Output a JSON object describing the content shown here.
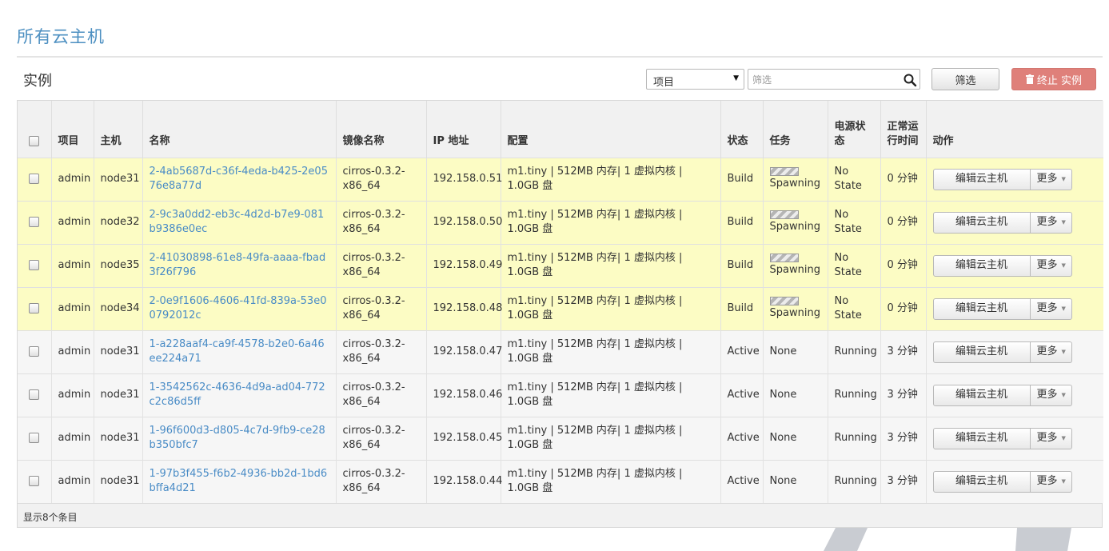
{
  "page": {
    "title": "所有云主机"
  },
  "section": {
    "heading": "实例"
  },
  "filter": {
    "project_option": "项目",
    "search_placeholder": "筛选",
    "filter_button": "筛选",
    "terminate_button": "终止 实例"
  },
  "table": {
    "headers": {
      "project": "项目",
      "host": "主机",
      "name": "名称",
      "image": "镜像名称",
      "ip": "IP 地址",
      "size": "配置",
      "status": "状态",
      "task": "任务",
      "power": "电源状态",
      "uptime": "正常运行时间",
      "actions": "动作"
    },
    "rows": [
      {
        "project": "admin",
        "host": "node31",
        "name": "2-4ab5687d-c36f-4eda-b425-2e0576e8a77d",
        "image": "cirros-0.3.2-x86_64",
        "ip": "192.158.0.51",
        "size": "m1.tiny | 512MB 内存| 1 虚拟内核 | 1.0GB 盘",
        "status": "Build",
        "task": "Spawning",
        "power": "No State",
        "uptime": "0 分钟",
        "edit": "编辑云主机",
        "more": "更多"
      },
      {
        "project": "admin",
        "host": "node32",
        "name": "2-9c3a0dd2-eb3c-4d2d-b7e9-081b9386e0ec",
        "image": "cirros-0.3.2-x86_64",
        "ip": "192.158.0.50",
        "size": "m1.tiny | 512MB 内存| 1 虚拟内核 | 1.0GB 盘",
        "status": "Build",
        "task": "Spawning",
        "power": "No State",
        "uptime": "0 分钟",
        "edit": "编辑云主机",
        "more": "更多"
      },
      {
        "project": "admin",
        "host": "node35",
        "name": "2-41030898-61e8-49fa-aaaa-fbad3f26f796",
        "image": "cirros-0.3.2-x86_64",
        "ip": "192.158.0.49",
        "size": "m1.tiny | 512MB 内存| 1 虚拟内核 | 1.0GB 盘",
        "status": "Build",
        "task": "Spawning",
        "power": "No State",
        "uptime": "0 分钟",
        "edit": "编辑云主机",
        "more": "更多"
      },
      {
        "project": "admin",
        "host": "node34",
        "name": "2-0e9f1606-4606-41fd-839a-53e00792012c",
        "image": "cirros-0.3.2-x86_64",
        "ip": "192.158.0.48",
        "size": "m1.tiny | 512MB 内存| 1 虚拟内核 | 1.0GB 盘",
        "status": "Build",
        "task": "Spawning",
        "power": "No State",
        "uptime": "0 分钟",
        "edit": "编辑云主机",
        "more": "更多"
      },
      {
        "project": "admin",
        "host": "node31",
        "name": "1-a228aaf4-ca9f-4578-b2e0-6a46ee224a71",
        "image": "cirros-0.3.2-x86_64",
        "ip": "192.158.0.47",
        "size": "m1.tiny | 512MB 内存| 1 虚拟内核 | 1.0GB 盘",
        "status": "Active",
        "task": "None",
        "power": "Running",
        "uptime": "3 分钟",
        "edit": "编辑云主机",
        "more": "更多"
      },
      {
        "project": "admin",
        "host": "node31",
        "name": "1-3542562c-4636-4d9a-ad04-772c2c86d5ff",
        "image": "cirros-0.3.2-x86_64",
        "ip": "192.158.0.46",
        "size": "m1.tiny | 512MB 内存| 1 虚拟内核 | 1.0GB 盘",
        "status": "Active",
        "task": "None",
        "power": "Running",
        "uptime": "3 分钟",
        "edit": "编辑云主机",
        "more": "更多"
      },
      {
        "project": "admin",
        "host": "node31",
        "name": "1-96f600d3-d805-4c7d-9fb9-ce28b350bfc7",
        "image": "cirros-0.3.2-x86_64",
        "ip": "192.158.0.45",
        "size": "m1.tiny | 512MB 内存| 1 虚拟内核 | 1.0GB 盘",
        "status": "Active",
        "task": "None",
        "power": "Running",
        "uptime": "3 分钟",
        "edit": "编辑云主机",
        "more": "更多"
      },
      {
        "project": "admin",
        "host": "node31",
        "name": "1-97b3f455-f6b2-4936-bb2d-1bd6bffa4d21",
        "image": "cirros-0.3.2-x86_64",
        "ip": "192.158.0.44",
        "size": "m1.tiny | 512MB 内存| 1 虚拟内核 | 1.0GB 盘",
        "status": "Active",
        "task": "None",
        "power": "Running",
        "uptime": "3 分钟",
        "edit": "编辑云主机",
        "more": "更多"
      }
    ],
    "footer": "显示8个条目"
  },
  "icons": {
    "search": "search-icon",
    "trash": "trash-icon",
    "dropdown": "chevron-down-icon",
    "checkbox": "checkbox",
    "spawning": "striped-progress-bar"
  },
  "colors": {
    "title": "#4c8fc1",
    "link": "#4a8cc6",
    "building_row": "#fcfcc4",
    "active_row": "#f6f6f6",
    "danger_button": "#df807a",
    "header_bg": "#f1f1f1"
  }
}
